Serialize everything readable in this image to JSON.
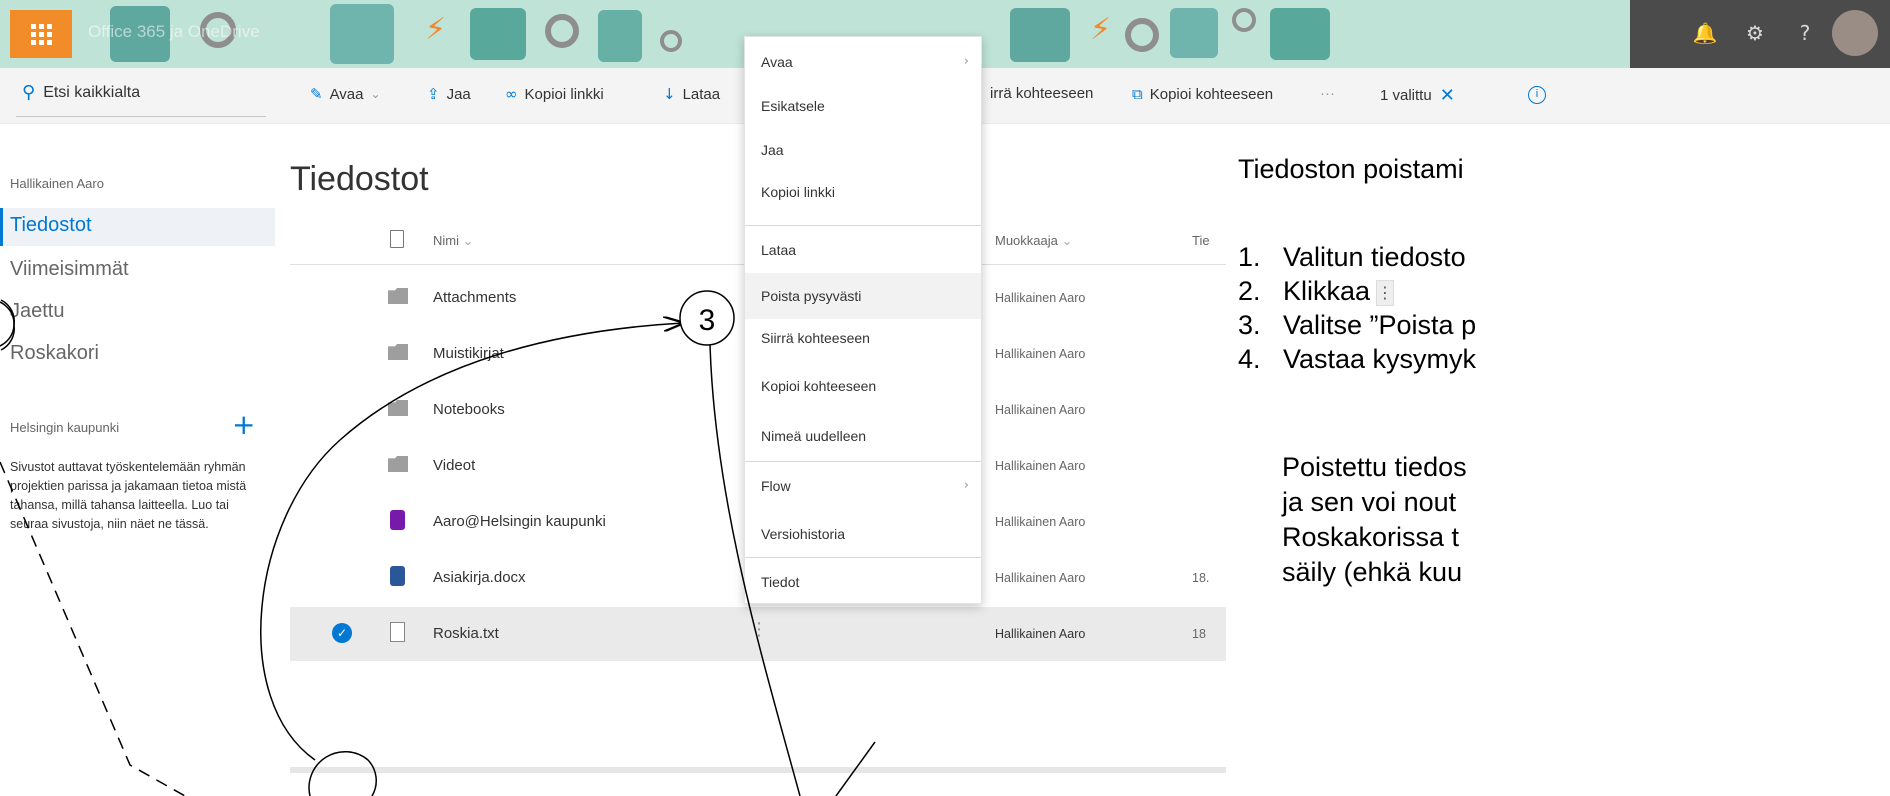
{
  "suite": {
    "title": "Office 365 ja OneDrive"
  },
  "commandbar": {
    "search_placeholder": "Etsi kaikkialta",
    "open_label": "Avaa",
    "share_label": "Jaa",
    "copy_link_label": "Kopioi linkki",
    "download_label": "Lataa",
    "move_to_label": "irrä kohteeseen",
    "copy_to_label": "Kopioi kohteeseen",
    "more_label": "···",
    "selected_label": "1 valittu",
    "close_symbol": "✕",
    "info_symbol": "i"
  },
  "nav": {
    "owner": "Hallikainen Aaro",
    "items": [
      {
        "label": "Tiedostot"
      },
      {
        "label": "Viimeisimmät"
      },
      {
        "label": "Jaettu"
      },
      {
        "label": "Roskakori"
      }
    ],
    "group_label": "Helsingin kaupunki",
    "group_plus": "+",
    "description": "Sivustot auttavat työskentelemään ryhmän projektien parissa ja jakamaan tietoa mistä tahansa, millä tahansa laitteella. Luo tai seuraa sivustoja, niin näet ne tässä."
  },
  "main": {
    "title": "Tiedostot",
    "columns": {
      "name": "Nimi",
      "modifier": "Muokkaaja",
      "date": "Tie"
    },
    "rows": [
      {
        "name": "Attachments",
        "modifier": "Hallikainen Aaro",
        "date": ""
      },
      {
        "name": "Muistikirjat",
        "modifier": "Hallikainen Aaro",
        "date": ""
      },
      {
        "name": "Notebooks",
        "modifier": "Hallikainen Aaro",
        "date": ""
      },
      {
        "name": "Videot",
        "modifier": "Hallikainen Aaro",
        "date": ""
      },
      {
        "name": "Aaro@Helsingin kaupunki",
        "modifier": "Hallikainen Aaro",
        "date": ""
      },
      {
        "name": "Asiakirja.docx",
        "modifier": "Hallikainen Aaro",
        "date": "18."
      },
      {
        "name": "Roskia.txt",
        "modifier": "Hallikainen Aaro",
        "date": "18"
      }
    ]
  },
  "context_menu": {
    "items": [
      {
        "label": "Avaa",
        "chevron": "›"
      },
      {
        "label": "Esikatsele"
      },
      {
        "label": "Jaa"
      },
      {
        "label": "Kopioi linkki"
      },
      {
        "label": "Lataa"
      },
      {
        "label": "Poista pysyvästi"
      },
      {
        "label": "Siirrä kohteeseen"
      },
      {
        "label": "Kopioi kohteeseen"
      },
      {
        "label": "Nimeä uudelleen"
      },
      {
        "label": "Flow",
        "chevron": "›"
      },
      {
        "label": "Versiohistoria"
      },
      {
        "label": "Tiedot"
      }
    ]
  },
  "instructions": {
    "title": "Tiedoston poistami",
    "steps": [
      {
        "num": "1.",
        "text": "Valitun tiedosto"
      },
      {
        "num": "2.",
        "text": "Klikkaa"
      },
      {
        "num": "3.",
        "text": "Valitse ”Poista p"
      },
      {
        "num": "4.",
        "text": "Vastaa kysymyk"
      }
    ],
    "kebab_symbol": "⋮",
    "note_lines": [
      "Poistettu tiedos",
      "ja sen voi nout",
      "Roskakorissa t",
      "säily (ehkä kuu"
    ]
  },
  "annotations": {
    "callout_number": "3"
  },
  "colors": {
    "accent": "#0078d4",
    "waffle": "#f28c28",
    "suite_bg": "#bfe3d6"
  }
}
